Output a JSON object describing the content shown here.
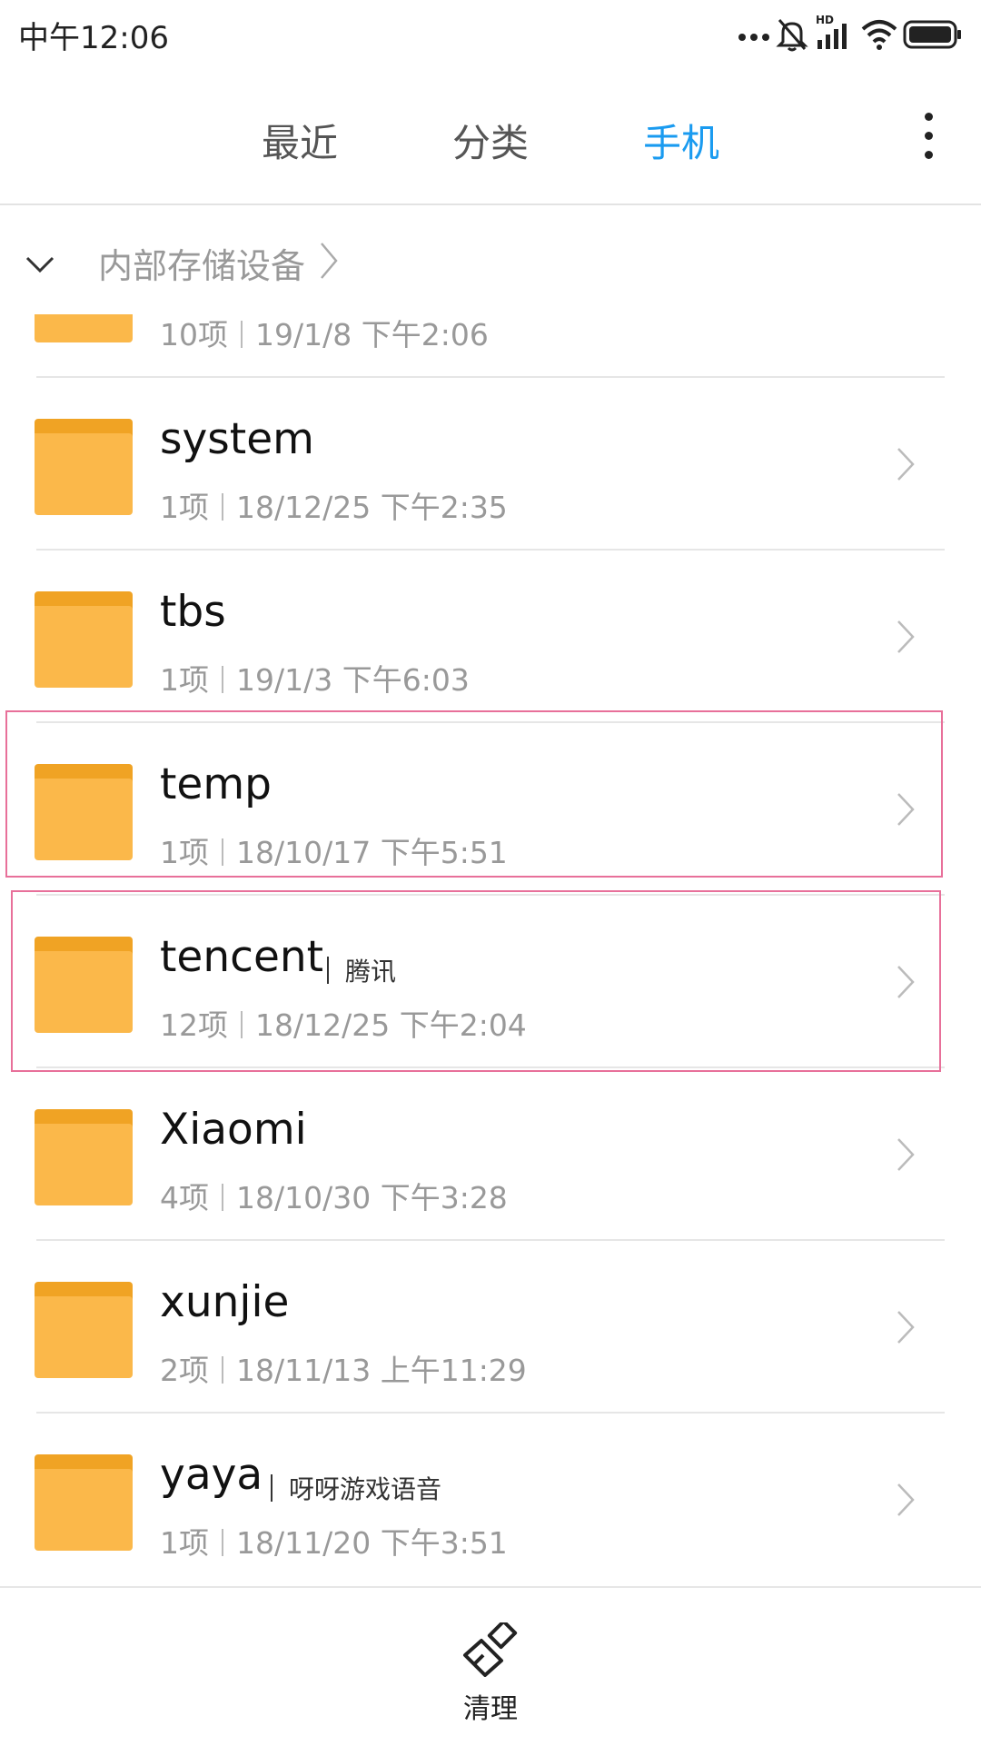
{
  "status_bar": {
    "time": "中午12:06",
    "icons": [
      "more-dots-icon",
      "mute-icon",
      "hd-signal-icon",
      "wifi-icon",
      "battery-icon"
    ]
  },
  "tabs": [
    {
      "label": "最近",
      "active": false
    },
    {
      "label": "分类",
      "active": false
    },
    {
      "label": "手机",
      "active": true
    }
  ],
  "breadcrumb": {
    "label": "内部存储设备"
  },
  "files": [
    {
      "name": "",
      "alias": "",
      "count": "10项",
      "date": "19/1/8 下午2:06"
    },
    {
      "name": "system",
      "alias": "",
      "count": "1项",
      "date": "18/12/25 下午2:35"
    },
    {
      "name": "tbs",
      "alias": "",
      "count": "1项",
      "date": "19/1/3 下午6:03"
    },
    {
      "name": "temp",
      "alias": "",
      "count": "1项",
      "date": "18/10/17 下午5:51"
    },
    {
      "name": "tencent",
      "alias": "腾讯",
      "count": "12项",
      "date": "18/12/25 下午2:04"
    },
    {
      "name": "Xiaomi",
      "alias": "",
      "count": "4项",
      "date": "18/10/30 下午3:28"
    },
    {
      "name": "xunjie",
      "alias": "",
      "count": "2项",
      "date": "18/11/13 上午11:29"
    },
    {
      "name": "yaya",
      "alias": "呀呀游戏语音",
      "count": "1项",
      "date": "18/11/20 下午3:51"
    }
  ],
  "bottom": {
    "clean_label": "清理"
  },
  "colors": {
    "accent": "#1a9bf0",
    "folder": "#fbb84a",
    "folder_tab": "#f0a324",
    "highlight": "#e8709a"
  }
}
